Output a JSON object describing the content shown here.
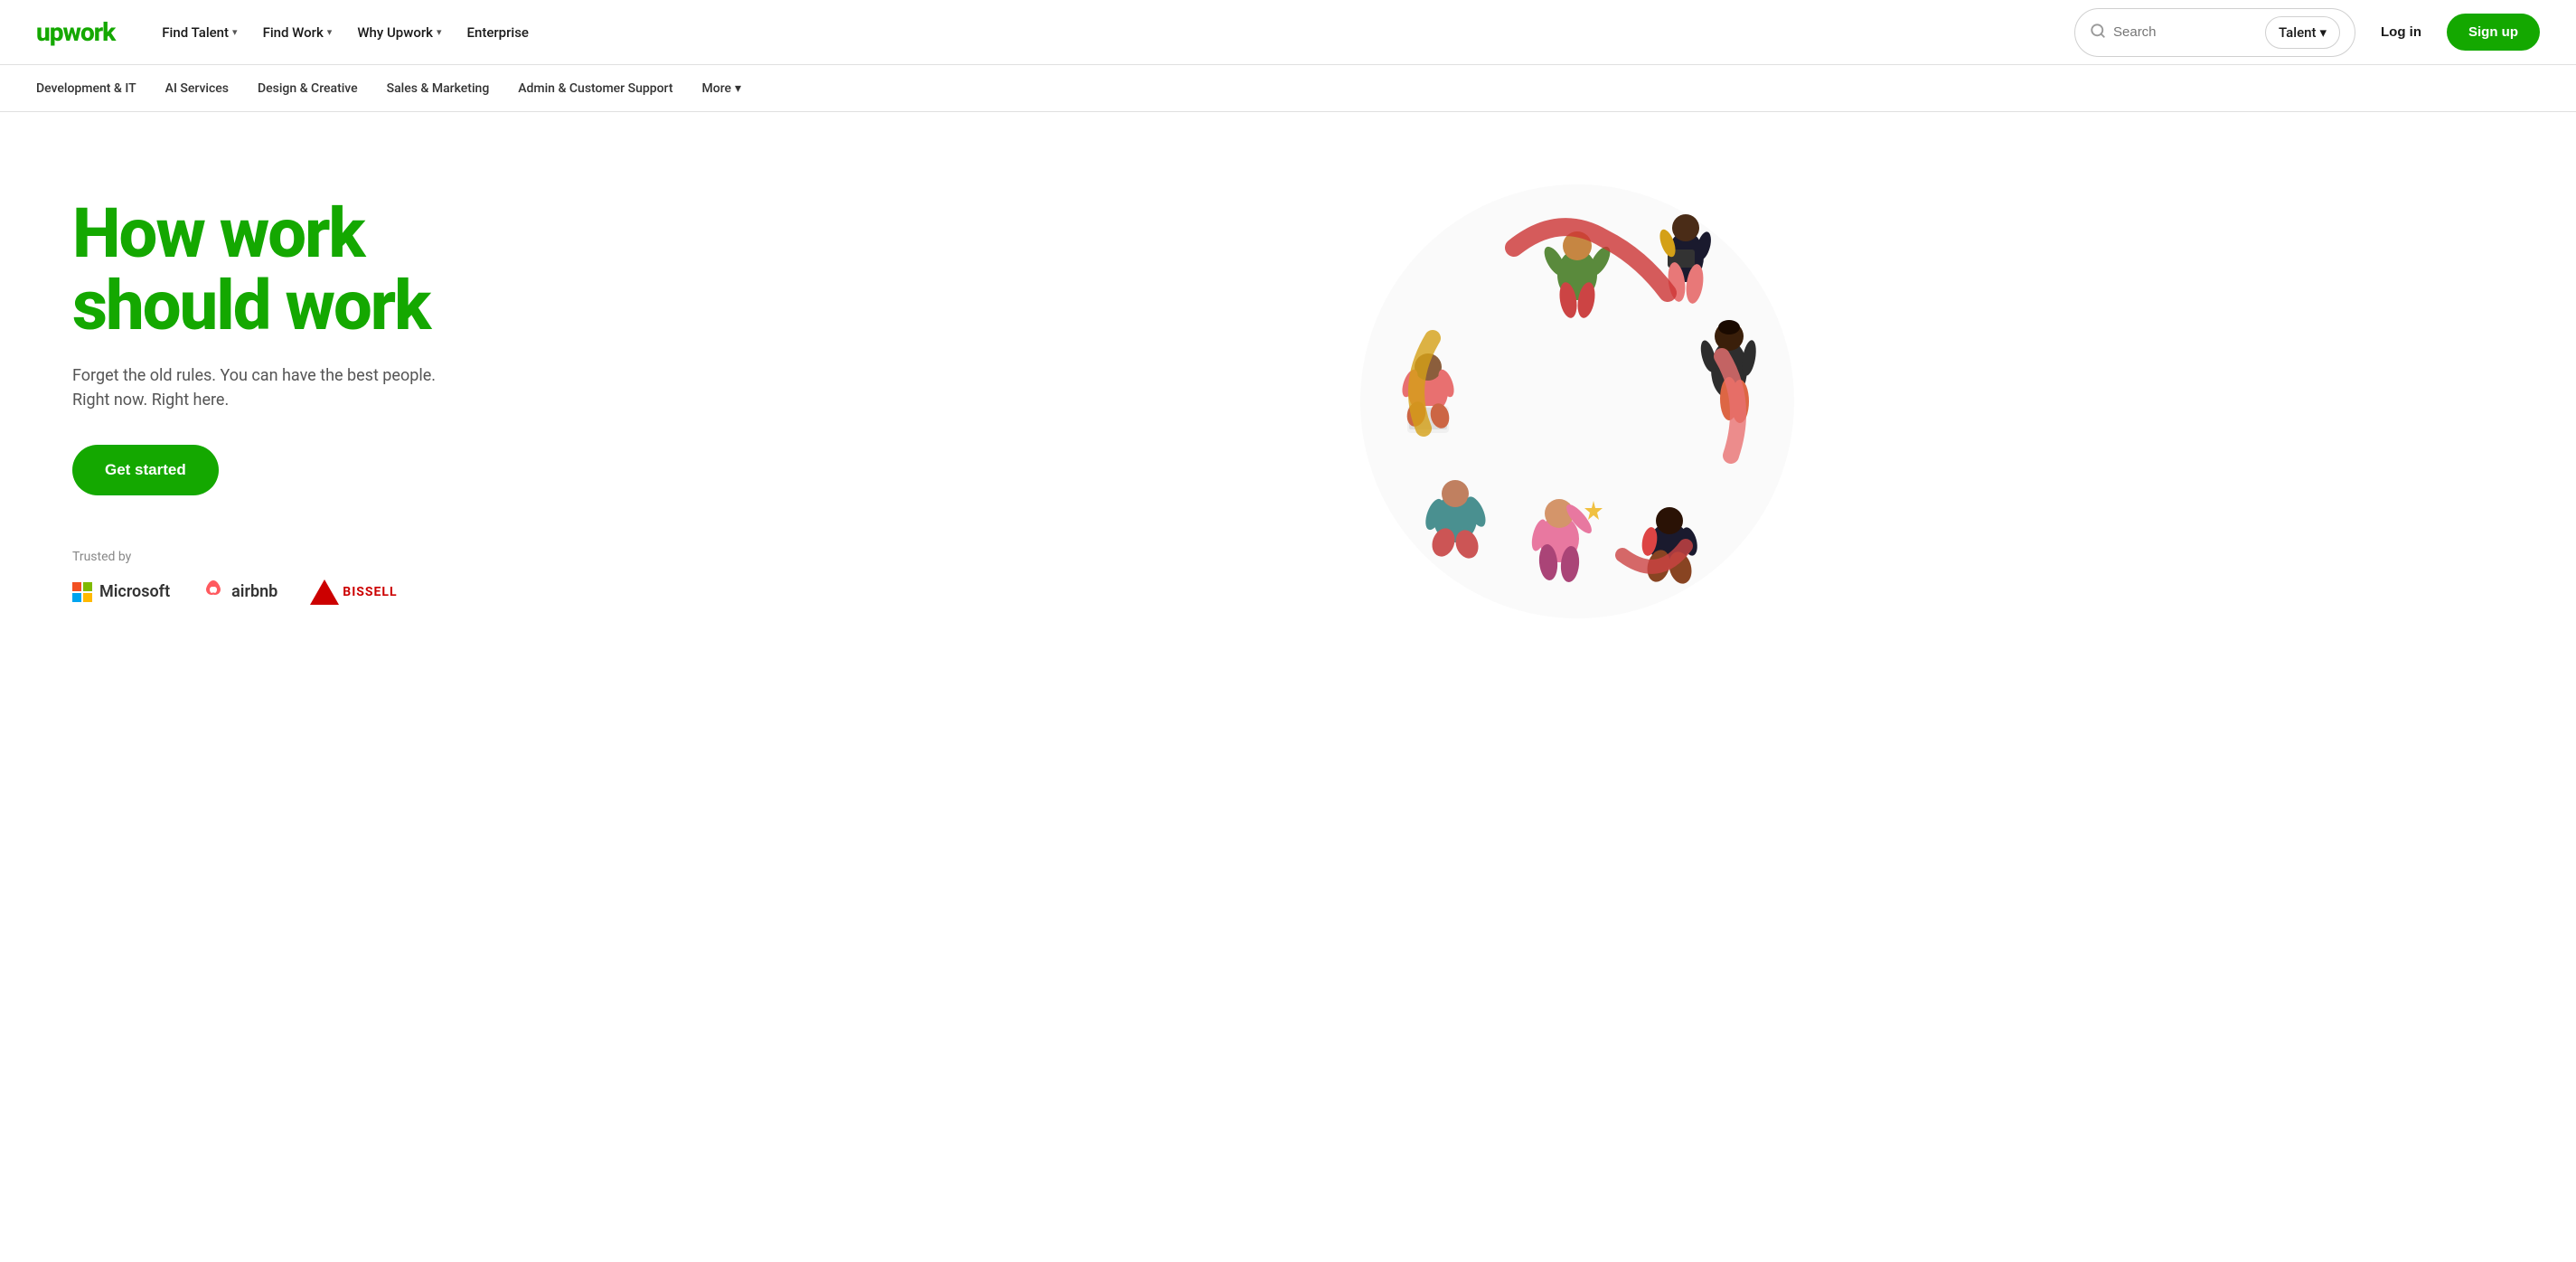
{
  "header": {
    "logo": "upwork",
    "nav": [
      {
        "label": "Find Talent",
        "hasDropdown": true
      },
      {
        "label": "Find Work",
        "hasDropdown": true
      },
      {
        "label": "Why Upwork",
        "hasDropdown": true
      },
      {
        "label": "Enterprise",
        "hasDropdown": false
      }
    ],
    "search": {
      "placeholder": "Search",
      "filter_label": "Talent",
      "filter_has_dropdown": true
    },
    "login_label": "Log in",
    "signup_label": "Sign up"
  },
  "secondary_nav": {
    "items": [
      {
        "label": "Development & IT"
      },
      {
        "label": "AI Services"
      },
      {
        "label": "Design & Creative"
      },
      {
        "label": "Sales & Marketing"
      },
      {
        "label": "Admin & Customer Support"
      },
      {
        "label": "More",
        "hasDropdown": true
      }
    ]
  },
  "hero": {
    "title_line1": "How work",
    "title_line2": "should work",
    "subtitle_line1": "Forget the old rules. You can have the best people.",
    "subtitle_line2": "Right now. Right here.",
    "cta_label": "Get started",
    "trusted_label": "Trusted by",
    "trusted_logos": [
      {
        "name": "Microsoft",
        "type": "microsoft"
      },
      {
        "name": "airbnb",
        "type": "airbnb"
      },
      {
        "name": "BISSELL",
        "type": "bissell"
      }
    ]
  }
}
